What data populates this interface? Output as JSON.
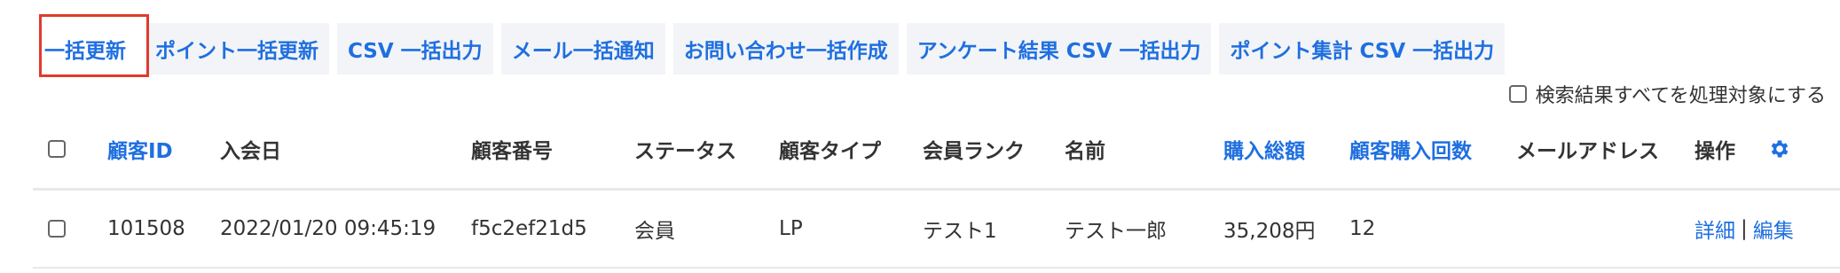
{
  "toolbar": {
    "buttons": [
      "一括更新",
      "ポイント一括更新",
      "CSV 一括出力",
      "メール一括通知",
      "お問い合わせ一括作成",
      "アンケート結果 CSV 一括出力",
      "ポイント集計 CSV 一括出力"
    ]
  },
  "select_all_label": "検索結果すべてを処理対象にする",
  "table": {
    "headers": {
      "customer_id": "顧客ID",
      "join_date": "入会日",
      "customer_number": "顧客番号",
      "status": "ステータス",
      "customer_type": "顧客タイプ",
      "member_rank": "会員ランク",
      "name": "名前",
      "total_purchase": "購入総額",
      "purchase_count": "顧客購入回数",
      "email": "メールアドレス",
      "actions": "操作"
    },
    "rows": [
      {
        "customer_id": "101508",
        "join_date": "2022/01/20 09:45:19",
        "customer_number": "f5c2ef21d5",
        "status": "会員",
        "customer_type": "LP",
        "member_rank": "テスト1",
        "name": "テスト一郎",
        "total_purchase": "35,208円",
        "purchase_count": "12",
        "email": "",
        "detail_link": "詳細",
        "separator": "|",
        "edit_link": "編集"
      }
    ]
  },
  "colors": {
    "accent": "#1f6fe0",
    "highlight": "#e03a2e",
    "button_bg": "#f2f4f7"
  }
}
